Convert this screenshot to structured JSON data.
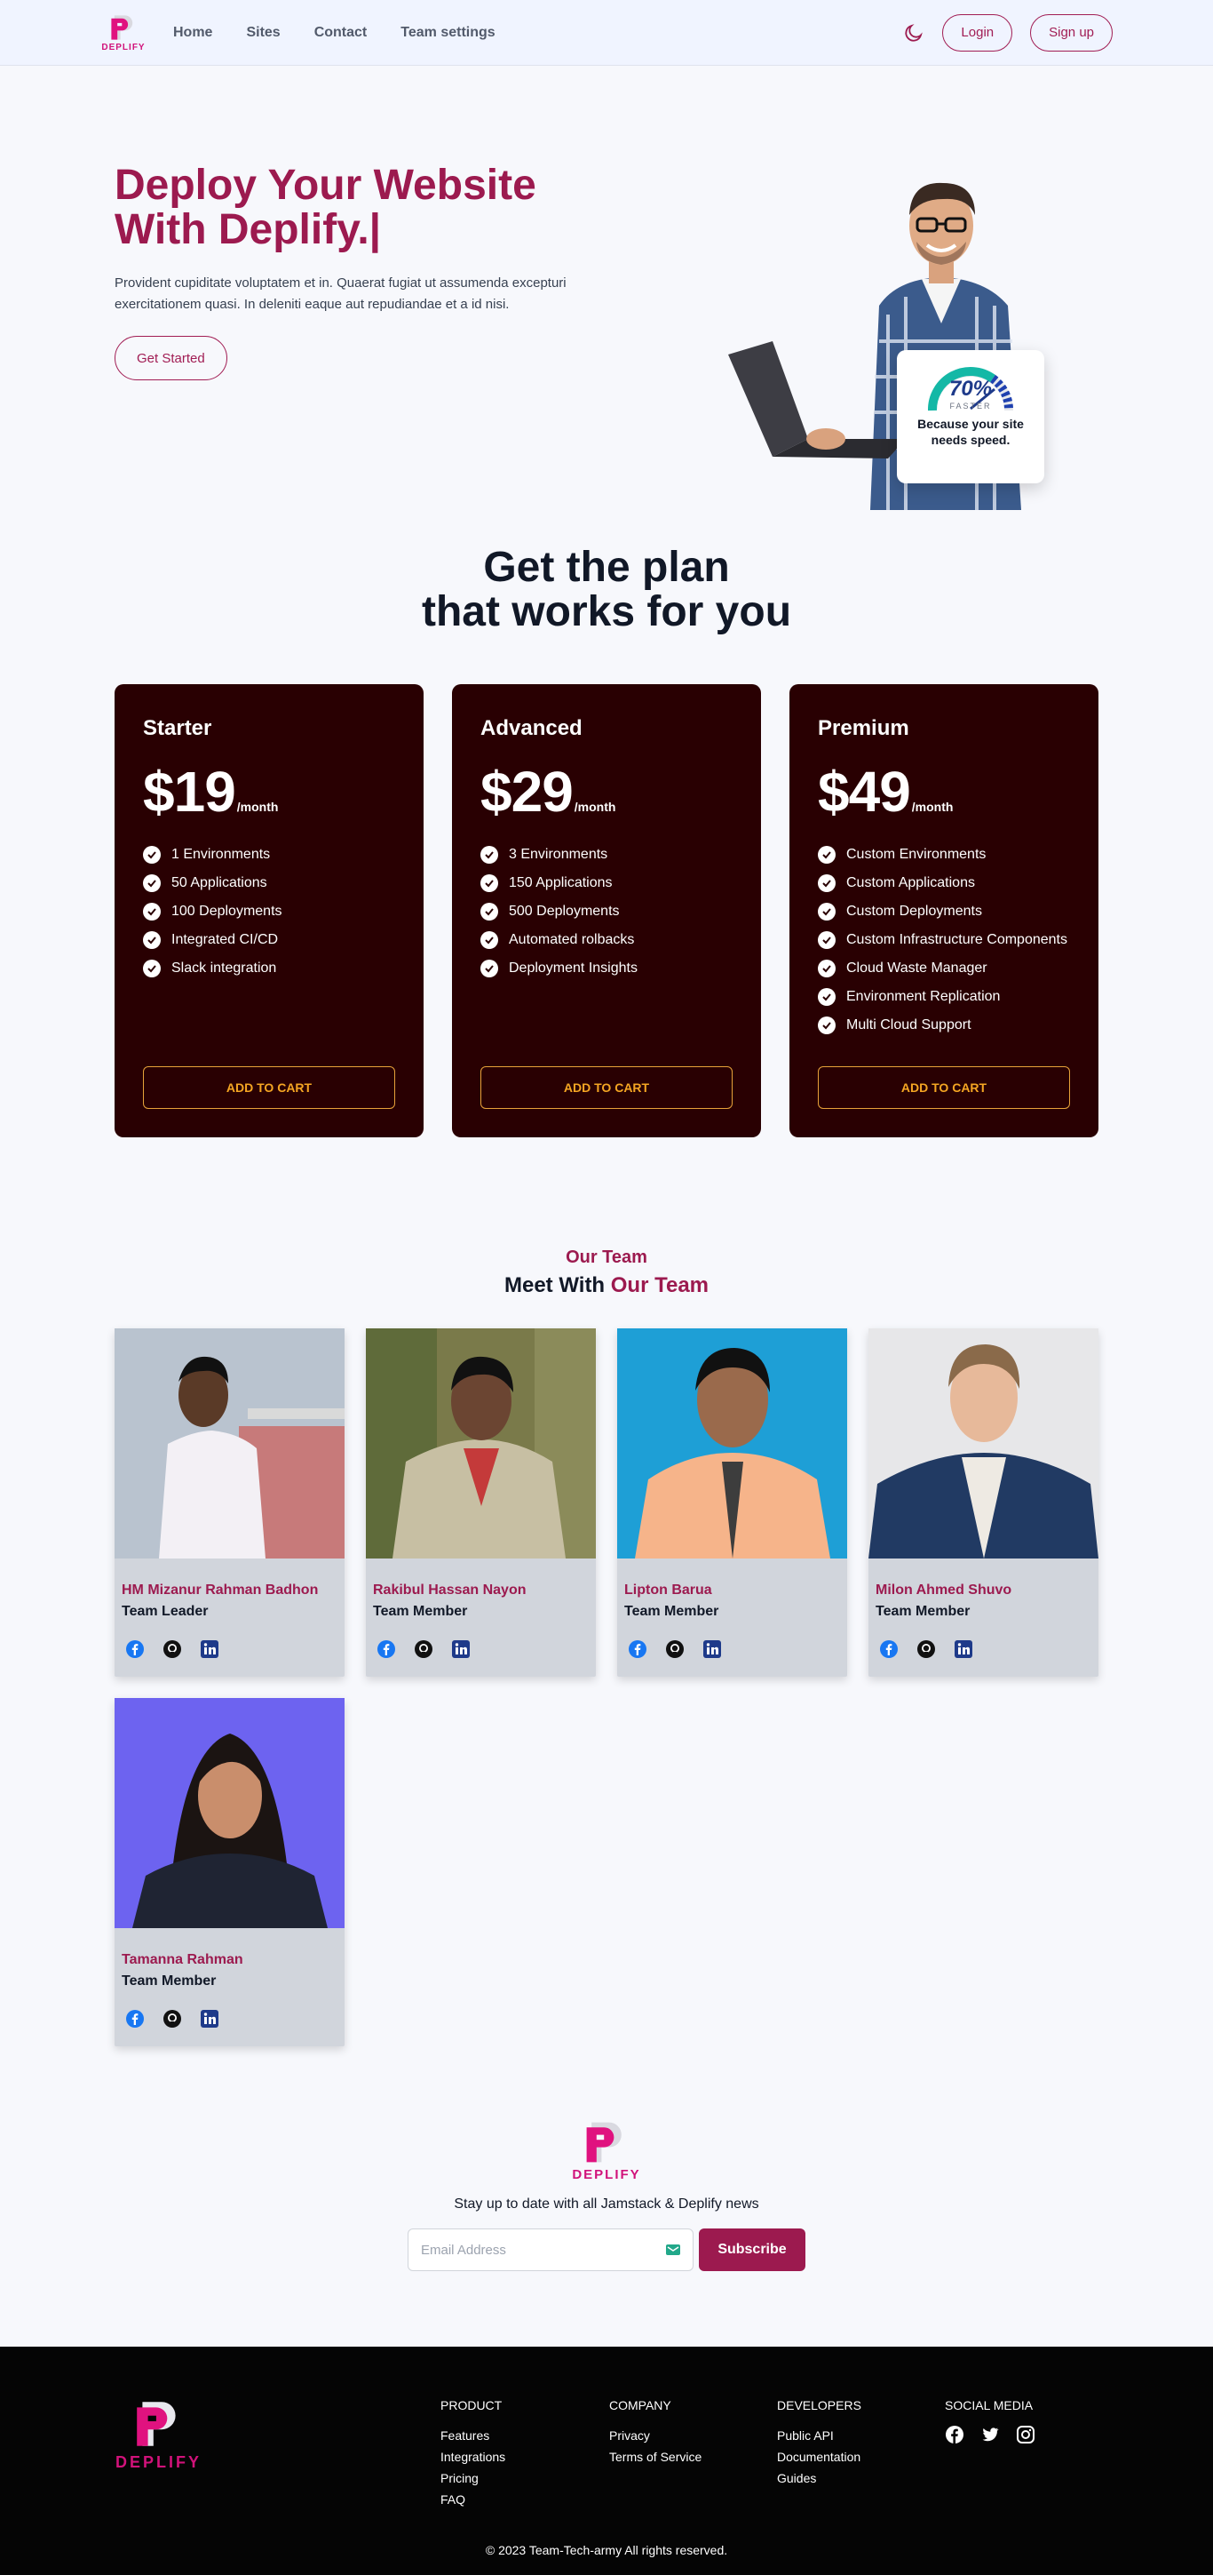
{
  "brand": {
    "name": "DEPLIFY"
  },
  "nav": {
    "links": [
      "Home",
      "Sites",
      "Contact",
      "Team settings"
    ],
    "login": "Login",
    "signup": "Sign up"
  },
  "hero": {
    "title_line1": "Deploy Your Website",
    "title_line2": "With Deplify.|",
    "description": "Provident cupiditate voluptatem et in. Quaerat fugiat ut assumenda excepturi exercitationem quasi. In deleniti eaque aut repudiandae et a id nisi.",
    "cta": "Get Started",
    "speed_card": {
      "percent": "70%",
      "faster": "FASTER",
      "text": "Because your site needs speed."
    }
  },
  "plans": {
    "title_line1": "Get the plan",
    "title_line2": "that works for you",
    "items": [
      {
        "name": "Starter",
        "price": "$19",
        "per": "/month",
        "features": [
          "1 Environments",
          "50 Applications",
          "100 Deployments",
          "Integrated CI/CD",
          "Slack integration"
        ],
        "cta": "ADD TO CART"
      },
      {
        "name": "Advanced",
        "price": "$29",
        "per": "/month",
        "features": [
          "3 Environments",
          "150 Applications",
          "500 Deployments",
          "Automated rolbacks",
          "Deployment Insights"
        ],
        "cta": "ADD TO CART"
      },
      {
        "name": "Premium",
        "price": "$49",
        "per": "/month",
        "features": [
          "Custom Environments",
          "Custom Applications",
          "Custom Deployments",
          "Custom Infrastructure Components",
          "Cloud Waste Manager",
          "Environment Replication",
          "Multi Cloud Support"
        ],
        "cta": "ADD TO CART"
      }
    ]
  },
  "team": {
    "eyebrow": "Our Team",
    "title_prefix": "Meet With ",
    "title_accent": "Our Team",
    "members": [
      {
        "name": "HM Mizanur Rahman Badhon",
        "role": "Team Leader"
      },
      {
        "name": "Rakibul Hassan Nayon",
        "role": "Team Member"
      },
      {
        "name": "Lipton Barua",
        "role": "Team Member"
      },
      {
        "name": "Milon Ahmed Shuvo",
        "role": "Team Member"
      },
      {
        "name": "Tamanna Rahman",
        "role": "Team Member"
      }
    ]
  },
  "newsletter": {
    "text": "Stay up to date with all Jamstack & Deplify news",
    "placeholder": "Email Address",
    "button": "Subscribe"
  },
  "footer": {
    "product": {
      "head": "PRODUCT",
      "items": [
        "Features",
        "Integrations",
        "Pricing",
        "FAQ"
      ]
    },
    "company": {
      "head": "COMPANY",
      "items": [
        "Privacy",
        "Terms of Service"
      ]
    },
    "developers": {
      "head": "DEVELOPERS",
      "items": [
        "Public API",
        "Documentation",
        "Guides"
      ]
    },
    "social": {
      "head": "SOCIAL MEDIA"
    },
    "copyright": "© 2023 Team-Tech-army All rights reserved."
  },
  "colors": {
    "brand": "#9c1a4f",
    "logo_pink": "#d1127a",
    "plan_bg": "#290002",
    "cta_gold": "#f5a623"
  }
}
